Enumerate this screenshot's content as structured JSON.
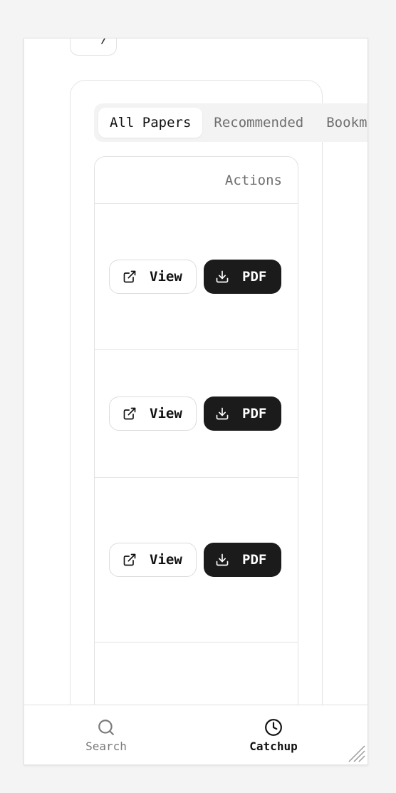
{
  "tabs": [
    {
      "label": "All Papers",
      "active": true
    },
    {
      "label": "Recommended",
      "active": false
    },
    {
      "label": "Bookma",
      "active": false
    }
  ],
  "table": {
    "actions_header": "Actions",
    "rows": [
      {
        "view_label": "View",
        "pdf_label": "PDF"
      },
      {
        "view_label": "View",
        "pdf_label": "PDF"
      },
      {
        "view_label": "View",
        "pdf_label": "PDF"
      }
    ]
  },
  "nav": {
    "search_label": "Search",
    "catchup_label": "Catchup"
  },
  "colors": {
    "background": "#f4f4f4",
    "primary_button": "#1b1b1b",
    "border": "#e2e2e2",
    "muted_text": "#6e6e6e"
  },
  "icons": {
    "view": "external-link-icon",
    "pdf": "download-icon",
    "search": "search-icon",
    "catchup": "clock-icon"
  }
}
